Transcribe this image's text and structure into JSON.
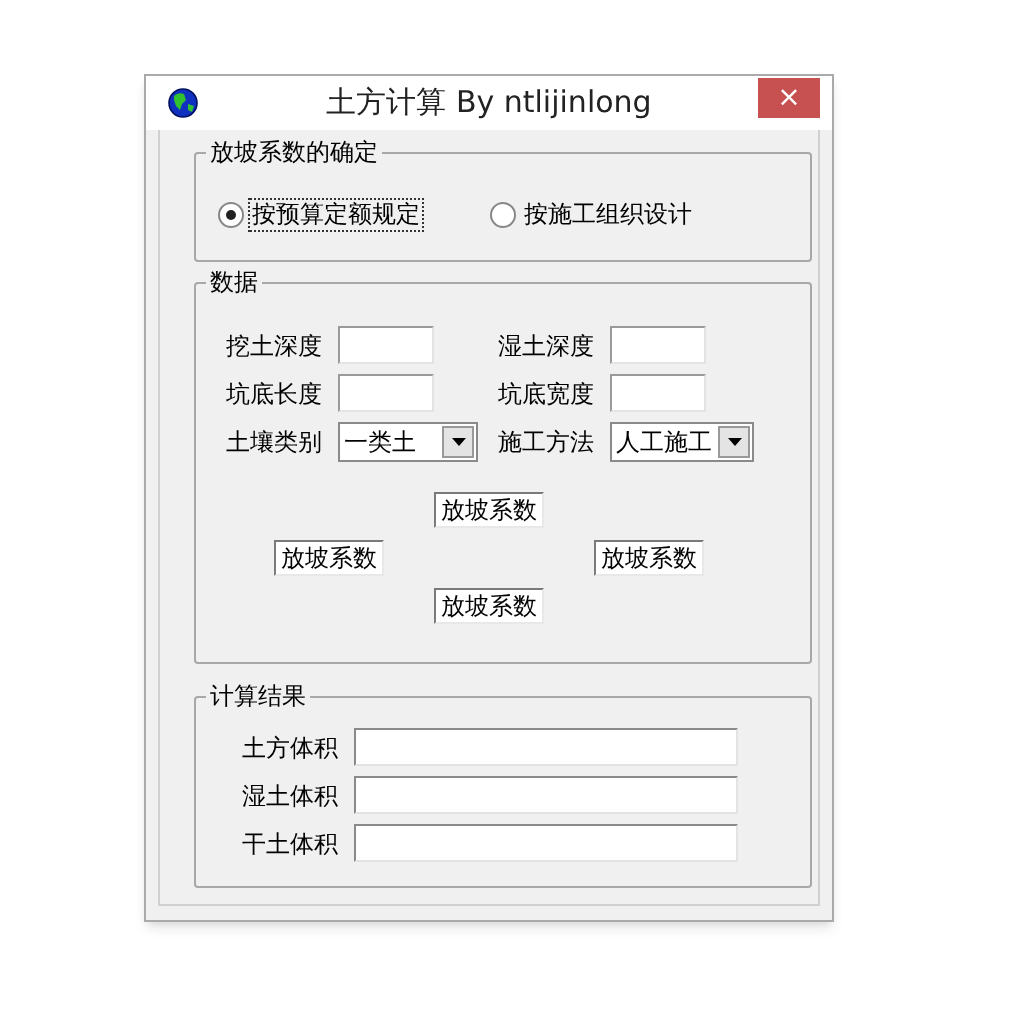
{
  "window": {
    "title": "土方计算 By ntlijinlong",
    "close": "×"
  },
  "slope_group": {
    "title": "放坡系数的确定",
    "options": [
      {
        "label": "按预算定额规定",
        "selected": true
      },
      {
        "label": "按施工组织设计",
        "selected": false
      }
    ]
  },
  "data_group": {
    "title": "数据",
    "fields": [
      {
        "label": "挖土深度",
        "kind": "text"
      },
      {
        "label": "湿土深度",
        "kind": "text"
      },
      {
        "label": "坑底长度",
        "kind": "text"
      },
      {
        "label": "坑底宽度",
        "kind": "text"
      },
      {
        "label": "土壤类别",
        "kind": "combo",
        "value": "一类土"
      },
      {
        "label": "施工方法",
        "kind": "combo",
        "value": "人工施工"
      }
    ],
    "buttons": [
      "放坡系数",
      "放坡系数",
      "放坡系数",
      "放坡系数"
    ]
  },
  "result_group": {
    "title": "计算结果",
    "fields": [
      {
        "label": "土方体积"
      },
      {
        "label": "湿土体积"
      },
      {
        "label": "干土体积"
      }
    ]
  }
}
